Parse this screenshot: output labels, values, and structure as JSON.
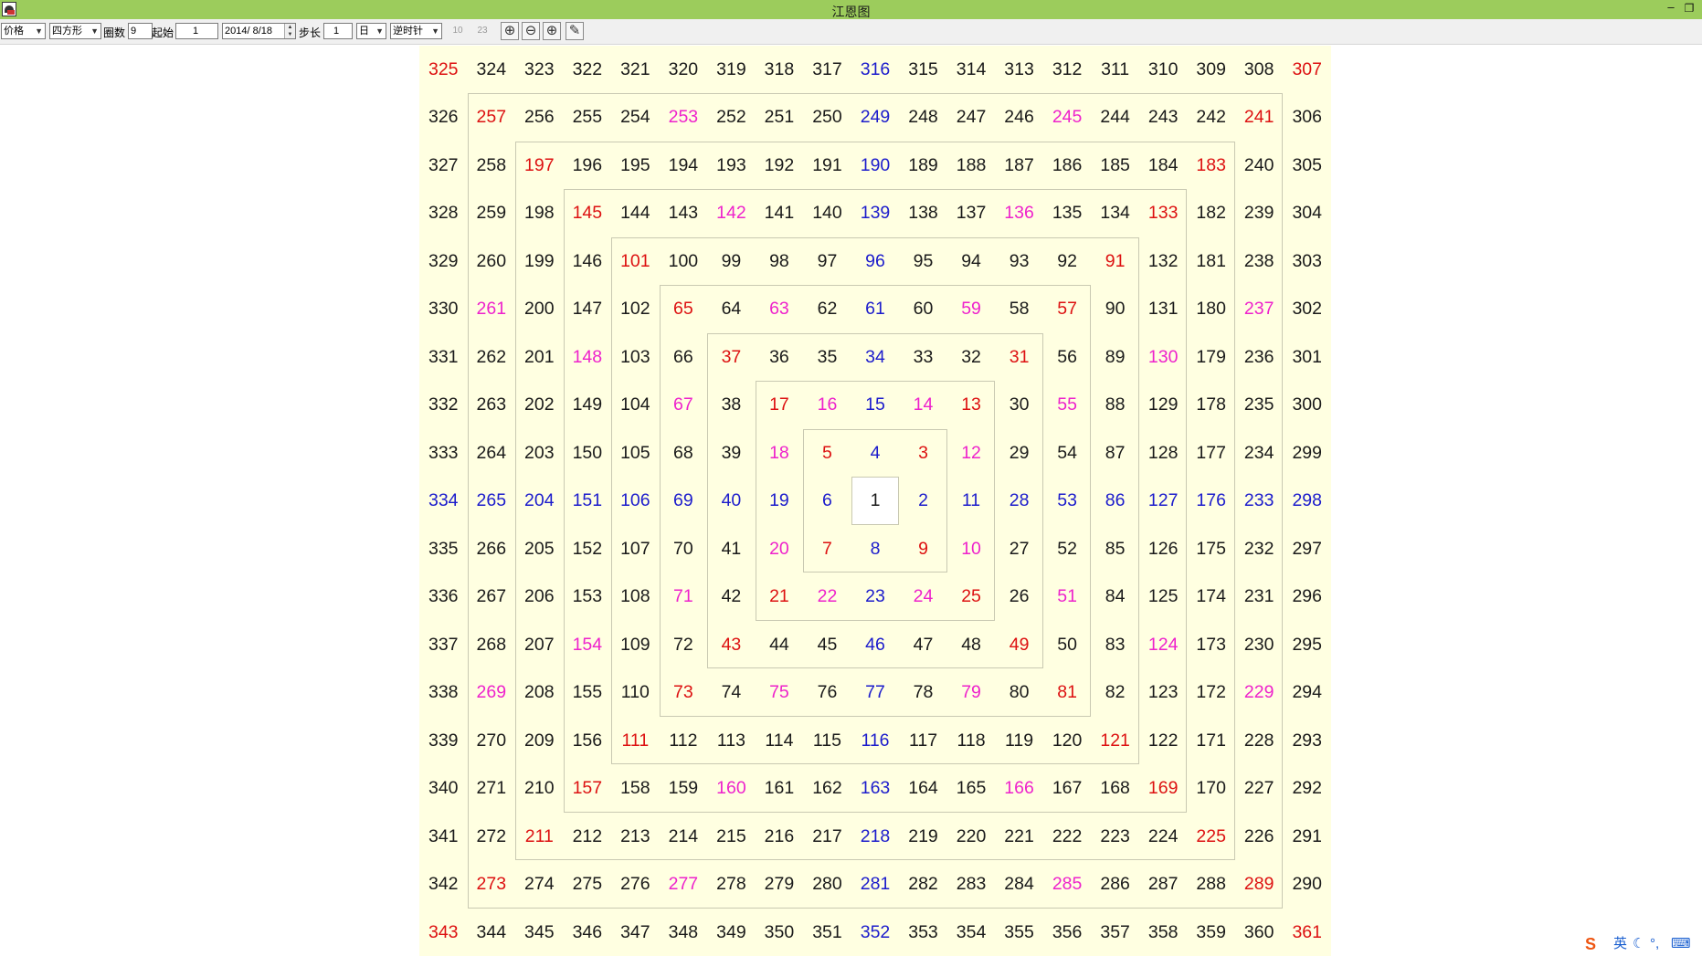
{
  "window": {
    "title": "江恩图",
    "minimize_label": "–",
    "restore_label": "❐"
  },
  "toolbar": {
    "price_select": "价格",
    "shape_select": "四方形",
    "rings_label": "圈数",
    "rings_value": "9",
    "start_label": "起始",
    "start_value": "1",
    "date_value": "2014/ 8/18",
    "step_label": "步长",
    "step_value": "1",
    "period_select": "日",
    "direction_select": "逆时针",
    "disabled_1": "10",
    "disabled_2": "23",
    "zoom_in_glyph": "⊕",
    "zoom_out_glyph": "⊖",
    "move_glyph": "⊕",
    "draw_glyph": "✎"
  },
  "gann_square": {
    "size": 19,
    "start": 1,
    "direction": "counterclockwise",
    "colors": {
      "black": "#1a1a1a",
      "red": "#dd1111",
      "magenta": "#ee22cc",
      "blue": "#1c1ccc",
      "background": "#ffffe1"
    },
    "rows": [
      [
        [
          325,
          "r"
        ],
        [
          324,
          "k"
        ],
        [
          323,
          "k"
        ],
        [
          322,
          "k"
        ],
        [
          321,
          "k"
        ],
        [
          320,
          "k"
        ],
        [
          319,
          "k"
        ],
        [
          318,
          "k"
        ],
        [
          317,
          "k"
        ],
        [
          316,
          "b"
        ],
        [
          315,
          "k"
        ],
        [
          314,
          "k"
        ],
        [
          313,
          "k"
        ],
        [
          312,
          "k"
        ],
        [
          311,
          "k"
        ],
        [
          310,
          "k"
        ],
        [
          309,
          "k"
        ],
        [
          308,
          "k"
        ],
        [
          307,
          "r"
        ]
      ],
      [
        [
          326,
          "k"
        ],
        [
          257,
          "r"
        ],
        [
          256,
          "k"
        ],
        [
          255,
          "k"
        ],
        [
          254,
          "k"
        ],
        [
          253,
          "m"
        ],
        [
          252,
          "k"
        ],
        [
          251,
          "k"
        ],
        [
          250,
          "k"
        ],
        [
          249,
          "b"
        ],
        [
          248,
          "k"
        ],
        [
          247,
          "k"
        ],
        [
          246,
          "k"
        ],
        [
          245,
          "m"
        ],
        [
          244,
          "k"
        ],
        [
          243,
          "k"
        ],
        [
          242,
          "k"
        ],
        [
          241,
          "r"
        ],
        [
          306,
          "k"
        ]
      ],
      [
        [
          327,
          "k"
        ],
        [
          258,
          "k"
        ],
        [
          197,
          "r"
        ],
        [
          196,
          "k"
        ],
        [
          195,
          "k"
        ],
        [
          194,
          "k"
        ],
        [
          193,
          "k"
        ],
        [
          192,
          "k"
        ],
        [
          191,
          "k"
        ],
        [
          190,
          "b"
        ],
        [
          189,
          "k"
        ],
        [
          188,
          "k"
        ],
        [
          187,
          "k"
        ],
        [
          186,
          "k"
        ],
        [
          185,
          "k"
        ],
        [
          184,
          "k"
        ],
        [
          183,
          "r"
        ],
        [
          240,
          "k"
        ],
        [
          305,
          "k"
        ]
      ],
      [
        [
          328,
          "k"
        ],
        [
          259,
          "k"
        ],
        [
          198,
          "k"
        ],
        [
          145,
          "r"
        ],
        [
          144,
          "k"
        ],
        [
          143,
          "k"
        ],
        [
          142,
          "m"
        ],
        [
          141,
          "k"
        ],
        [
          140,
          "k"
        ],
        [
          139,
          "b"
        ],
        [
          138,
          "k"
        ],
        [
          137,
          "k"
        ],
        [
          136,
          "m"
        ],
        [
          135,
          "k"
        ],
        [
          134,
          "k"
        ],
        [
          133,
          "r"
        ],
        [
          182,
          "k"
        ],
        [
          239,
          "k"
        ],
        [
          304,
          "k"
        ]
      ],
      [
        [
          329,
          "k"
        ],
        [
          260,
          "k"
        ],
        [
          199,
          "k"
        ],
        [
          146,
          "k"
        ],
        [
          101,
          "r"
        ],
        [
          100,
          "k"
        ],
        [
          99,
          "k"
        ],
        [
          98,
          "k"
        ],
        [
          97,
          "k"
        ],
        [
          96,
          "b"
        ],
        [
          95,
          "k"
        ],
        [
          94,
          "k"
        ],
        [
          93,
          "k"
        ],
        [
          92,
          "k"
        ],
        [
          91,
          "r"
        ],
        [
          132,
          "k"
        ],
        [
          181,
          "k"
        ],
        [
          238,
          "k"
        ],
        [
          303,
          "k"
        ]
      ],
      [
        [
          330,
          "k"
        ],
        [
          261,
          "m"
        ],
        [
          200,
          "k"
        ],
        [
          147,
          "k"
        ],
        [
          102,
          "k"
        ],
        [
          65,
          "r"
        ],
        [
          64,
          "k"
        ],
        [
          63,
          "m"
        ],
        [
          62,
          "k"
        ],
        [
          61,
          "b"
        ],
        [
          60,
          "k"
        ],
        [
          59,
          "m"
        ],
        [
          58,
          "k"
        ],
        [
          57,
          "r"
        ],
        [
          90,
          "k"
        ],
        [
          131,
          "k"
        ],
        [
          180,
          "k"
        ],
        [
          237,
          "m"
        ],
        [
          302,
          "k"
        ]
      ],
      [
        [
          331,
          "k"
        ],
        [
          262,
          "k"
        ],
        [
          201,
          "k"
        ],
        [
          148,
          "m"
        ],
        [
          103,
          "k"
        ],
        [
          66,
          "k"
        ],
        [
          37,
          "r"
        ],
        [
          36,
          "k"
        ],
        [
          35,
          "k"
        ],
        [
          34,
          "b"
        ],
        [
          33,
          "k"
        ],
        [
          32,
          "k"
        ],
        [
          31,
          "r"
        ],
        [
          56,
          "k"
        ],
        [
          89,
          "k"
        ],
        [
          130,
          "m"
        ],
        [
          179,
          "k"
        ],
        [
          236,
          "k"
        ],
        [
          301,
          "k"
        ]
      ],
      [
        [
          332,
          "k"
        ],
        [
          263,
          "k"
        ],
        [
          202,
          "k"
        ],
        [
          149,
          "k"
        ],
        [
          104,
          "k"
        ],
        [
          67,
          "m"
        ],
        [
          38,
          "k"
        ],
        [
          17,
          "r"
        ],
        [
          16,
          "m"
        ],
        [
          15,
          "b"
        ],
        [
          14,
          "m"
        ],
        [
          13,
          "r"
        ],
        [
          30,
          "k"
        ],
        [
          55,
          "m"
        ],
        [
          88,
          "k"
        ],
        [
          129,
          "k"
        ],
        [
          178,
          "k"
        ],
        [
          235,
          "k"
        ],
        [
          300,
          "k"
        ]
      ],
      [
        [
          333,
          "k"
        ],
        [
          264,
          "k"
        ],
        [
          203,
          "k"
        ],
        [
          150,
          "k"
        ],
        [
          105,
          "k"
        ],
        [
          68,
          "k"
        ],
        [
          39,
          "k"
        ],
        [
          18,
          "m"
        ],
        [
          5,
          "r"
        ],
        [
          4,
          "b"
        ],
        [
          3,
          "r"
        ],
        [
          12,
          "m"
        ],
        [
          29,
          "k"
        ],
        [
          54,
          "k"
        ],
        [
          87,
          "k"
        ],
        [
          128,
          "k"
        ],
        [
          177,
          "k"
        ],
        [
          234,
          "k"
        ],
        [
          299,
          "k"
        ]
      ],
      [
        [
          334,
          "b"
        ],
        [
          265,
          "b"
        ],
        [
          204,
          "b"
        ],
        [
          151,
          "b"
        ],
        [
          106,
          "b"
        ],
        [
          69,
          "b"
        ],
        [
          40,
          "b"
        ],
        [
          19,
          "b"
        ],
        [
          6,
          "b"
        ],
        [
          1,
          "k"
        ],
        [
          2,
          "b"
        ],
        [
          11,
          "b"
        ],
        [
          28,
          "b"
        ],
        [
          53,
          "b"
        ],
        [
          86,
          "b"
        ],
        [
          127,
          "b"
        ],
        [
          176,
          "b"
        ],
        [
          233,
          "b"
        ],
        [
          298,
          "b"
        ]
      ],
      [
        [
          335,
          "k"
        ],
        [
          266,
          "k"
        ],
        [
          205,
          "k"
        ],
        [
          152,
          "k"
        ],
        [
          107,
          "k"
        ],
        [
          70,
          "k"
        ],
        [
          41,
          "k"
        ],
        [
          20,
          "m"
        ],
        [
          7,
          "r"
        ],
        [
          8,
          "b"
        ],
        [
          9,
          "r"
        ],
        [
          10,
          "m"
        ],
        [
          27,
          "k"
        ],
        [
          52,
          "k"
        ],
        [
          85,
          "k"
        ],
        [
          126,
          "k"
        ],
        [
          175,
          "k"
        ],
        [
          232,
          "k"
        ],
        [
          297,
          "k"
        ]
      ],
      [
        [
          336,
          "k"
        ],
        [
          267,
          "k"
        ],
        [
          206,
          "k"
        ],
        [
          153,
          "k"
        ],
        [
          108,
          "k"
        ],
        [
          71,
          "m"
        ],
        [
          42,
          "k"
        ],
        [
          21,
          "r"
        ],
        [
          22,
          "m"
        ],
        [
          23,
          "b"
        ],
        [
          24,
          "m"
        ],
        [
          25,
          "r"
        ],
        [
          26,
          "k"
        ],
        [
          51,
          "m"
        ],
        [
          84,
          "k"
        ],
        [
          125,
          "k"
        ],
        [
          174,
          "k"
        ],
        [
          231,
          "k"
        ],
        [
          296,
          "k"
        ]
      ],
      [
        [
          337,
          "k"
        ],
        [
          268,
          "k"
        ],
        [
          207,
          "k"
        ],
        [
          154,
          "m"
        ],
        [
          109,
          "k"
        ],
        [
          72,
          "k"
        ],
        [
          43,
          "r"
        ],
        [
          44,
          "k"
        ],
        [
          45,
          "k"
        ],
        [
          46,
          "b"
        ],
        [
          47,
          "k"
        ],
        [
          48,
          "k"
        ],
        [
          49,
          "r"
        ],
        [
          50,
          "k"
        ],
        [
          83,
          "k"
        ],
        [
          124,
          "m"
        ],
        [
          173,
          "k"
        ],
        [
          230,
          "k"
        ],
        [
          295,
          "k"
        ]
      ],
      [
        [
          338,
          "k"
        ],
        [
          269,
          "m"
        ],
        [
          208,
          "k"
        ],
        [
          155,
          "k"
        ],
        [
          110,
          "k"
        ],
        [
          73,
          "r"
        ],
        [
          74,
          "k"
        ],
        [
          75,
          "m"
        ],
        [
          76,
          "k"
        ],
        [
          77,
          "b"
        ],
        [
          78,
          "k"
        ],
        [
          79,
          "m"
        ],
        [
          80,
          "k"
        ],
        [
          81,
          "r"
        ],
        [
          82,
          "k"
        ],
        [
          123,
          "k"
        ],
        [
          172,
          "k"
        ],
        [
          229,
          "m"
        ],
        [
          294,
          "k"
        ]
      ],
      [
        [
          339,
          "k"
        ],
        [
          270,
          "k"
        ],
        [
          209,
          "k"
        ],
        [
          156,
          "k"
        ],
        [
          111,
          "r"
        ],
        [
          112,
          "k"
        ],
        [
          113,
          "k"
        ],
        [
          114,
          "k"
        ],
        [
          115,
          "k"
        ],
        [
          116,
          "b"
        ],
        [
          117,
          "k"
        ],
        [
          118,
          "k"
        ],
        [
          119,
          "k"
        ],
        [
          120,
          "k"
        ],
        [
          121,
          "r"
        ],
        [
          122,
          "k"
        ],
        [
          171,
          "k"
        ],
        [
          228,
          "k"
        ],
        [
          293,
          "k"
        ]
      ],
      [
        [
          340,
          "k"
        ],
        [
          271,
          "k"
        ],
        [
          210,
          "k"
        ],
        [
          157,
          "r"
        ],
        [
          158,
          "k"
        ],
        [
          159,
          "k"
        ],
        [
          160,
          "m"
        ],
        [
          161,
          "k"
        ],
        [
          162,
          "k"
        ],
        [
          163,
          "b"
        ],
        [
          164,
          "k"
        ],
        [
          165,
          "k"
        ],
        [
          166,
          "m"
        ],
        [
          167,
          "k"
        ],
        [
          168,
          "k"
        ],
        [
          169,
          "r"
        ],
        [
          170,
          "k"
        ],
        [
          227,
          "k"
        ],
        [
          292,
          "k"
        ]
      ],
      [
        [
          341,
          "k"
        ],
        [
          272,
          "k"
        ],
        [
          211,
          "r"
        ],
        [
          212,
          "k"
        ],
        [
          213,
          "k"
        ],
        [
          214,
          "k"
        ],
        [
          215,
          "k"
        ],
        [
          216,
          "k"
        ],
        [
          217,
          "k"
        ],
        [
          218,
          "b"
        ],
        [
          219,
          "k"
        ],
        [
          220,
          "k"
        ],
        [
          221,
          "k"
        ],
        [
          222,
          "k"
        ],
        [
          223,
          "k"
        ],
        [
          224,
          "k"
        ],
        [
          225,
          "r"
        ],
        [
          226,
          "k"
        ],
        [
          291,
          "k"
        ]
      ],
      [
        [
          342,
          "k"
        ],
        [
          273,
          "r"
        ],
        [
          274,
          "k"
        ],
        [
          275,
          "k"
        ],
        [
          276,
          "k"
        ],
        [
          277,
          "m"
        ],
        [
          278,
          "k"
        ],
        [
          279,
          "k"
        ],
        [
          280,
          "k"
        ],
        [
          281,
          "b"
        ],
        [
          282,
          "k"
        ],
        [
          283,
          "k"
        ],
        [
          284,
          "k"
        ],
        [
          285,
          "m"
        ],
        [
          286,
          "k"
        ],
        [
          287,
          "k"
        ],
        [
          288,
          "k"
        ],
        [
          289,
          "r"
        ],
        [
          290,
          "k"
        ]
      ],
      [
        [
          343,
          "r"
        ],
        [
          344,
          "k"
        ],
        [
          345,
          "k"
        ],
        [
          346,
          "k"
        ],
        [
          347,
          "k"
        ],
        [
          348,
          "k"
        ],
        [
          349,
          "k"
        ],
        [
          350,
          "k"
        ],
        [
          351,
          "k"
        ],
        [
          352,
          "b"
        ],
        [
          353,
          "k"
        ],
        [
          354,
          "k"
        ],
        [
          355,
          "k"
        ],
        [
          356,
          "k"
        ],
        [
          357,
          "k"
        ],
        [
          358,
          "k"
        ],
        [
          359,
          "k"
        ],
        [
          360,
          "k"
        ],
        [
          361,
          "r"
        ]
      ]
    ]
  },
  "tray": {
    "ime_logo": "S",
    "ime_mode": "英",
    "icons": [
      "moon-icon",
      "punctuation-icon",
      "keyboard-icon"
    ]
  }
}
